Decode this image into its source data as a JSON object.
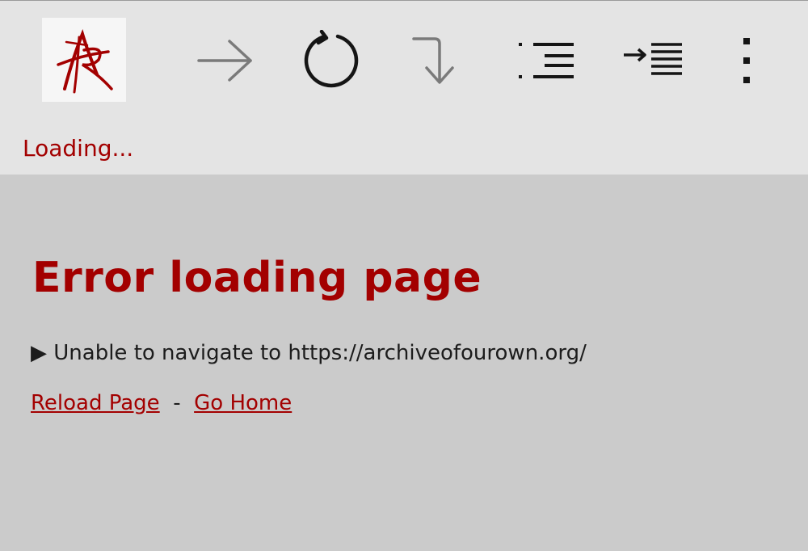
{
  "toolbar": {
    "logo_icon": "ao3-logo-icon",
    "buttons": [
      {
        "name": "forward-button",
        "icon": "arrow-right-icon"
      },
      {
        "name": "reload-button",
        "icon": "reload-icon"
      },
      {
        "name": "skip-button",
        "icon": "curved-arrow-down-icon"
      },
      {
        "name": "list-button",
        "icon": "list-icon"
      },
      {
        "name": "indent-button",
        "icon": "indent-icon"
      },
      {
        "name": "menu-button",
        "icon": "more-vertical-icon"
      }
    ],
    "status": "Loading..."
  },
  "error": {
    "title": "Error loading page",
    "detail": "▶ Unable to navigate to https://archiveofourown.org/",
    "reload_label": "Reload Page",
    "separator": "-",
    "home_label": "Go Home"
  },
  "colors": {
    "accent": "#a30000",
    "toolbar_bg": "#e4e4e4",
    "content_bg": "#cbcbcb"
  }
}
